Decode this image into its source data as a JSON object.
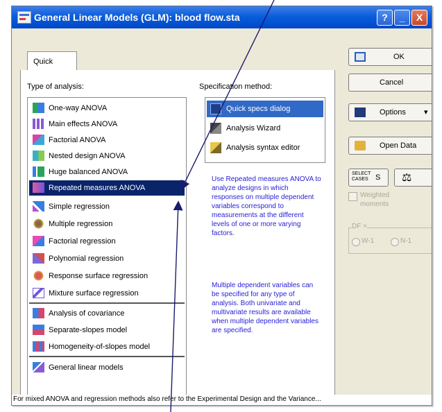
{
  "window": {
    "title": "General Linear Models (GLM): blood flow.sta",
    "buttons": {
      "help": "?",
      "minimize": "_",
      "close": "X"
    }
  },
  "tabs": [
    {
      "label": "Quick"
    }
  ],
  "type_of_analysis": {
    "label": "Type of analysis:",
    "items": [
      {
        "label": "One-way ANOVA",
        "icon": "one-way-anova-icon"
      },
      {
        "label": "Main effects ANOVA",
        "icon": "main-effects-icon"
      },
      {
        "label": "Factorial ANOVA",
        "icon": "factorial-icon"
      },
      {
        "label": "Nested design ANOVA",
        "icon": "nested-design-icon"
      },
      {
        "label": "Huge balanced ANOVA",
        "icon": "huge-balanced-icon"
      },
      {
        "label": "Repeated measures ANOVA",
        "icon": "repeated-measures-icon",
        "selected": true
      },
      {
        "label": "Simple regression",
        "icon": "simple-regression-icon"
      },
      {
        "label": "Multiple regression",
        "icon": "multiple-regression-icon"
      },
      {
        "label": "Factorial regression",
        "icon": "factorial-regression-icon"
      },
      {
        "label": "Polynomial regression",
        "icon": "polynomial-regression-icon"
      },
      {
        "label": "Response surface regression",
        "icon": "response-surface-icon"
      },
      {
        "label": "Mixture surface regression",
        "icon": "mixture-surface-icon"
      },
      {
        "label": "Analysis of covariance",
        "icon": "covariance-icon"
      },
      {
        "label": "Separate-slopes model",
        "icon": "separate-slopes-icon"
      },
      {
        "label": "Homogeneity-of-slopes model",
        "icon": "homogeneity-slopes-icon"
      },
      {
        "label": "General linear models",
        "icon": "general-linear-icon"
      }
    ]
  },
  "specification_method": {
    "label": "Specification method:",
    "items": [
      {
        "label": "Quick specs dialog",
        "icon": "quick-specs-icon",
        "selected": true
      },
      {
        "label": "Analysis Wizard",
        "icon": "wizard-icon"
      },
      {
        "label": "Analysis syntax editor",
        "icon": "syntax-editor-icon"
      }
    ]
  },
  "description": {
    "para1": "Use Repeated measures ANOVA to analyze designs in which responses on multiple dependent variables correspond to measurements at the different levels of one or more varying factors.",
    "para2": "Multiple dependent variables can be specified for any type of analysis. Both univariate and multivariate results are available when multiple dependent variables are specified."
  },
  "right_panel": {
    "ok": "OK",
    "cancel": "Cancel",
    "options": "Options",
    "open_data": "Open Data",
    "select_cases": "SELECT CASES",
    "weighted_moments": "Weighted moments",
    "df_label": "DF =",
    "df_option1": "W-1",
    "df_option2": "N-1"
  },
  "status_bar": {
    "text": "For mixed ANOVA and regression methods also refer to the Experimental Design and the Variance..."
  }
}
